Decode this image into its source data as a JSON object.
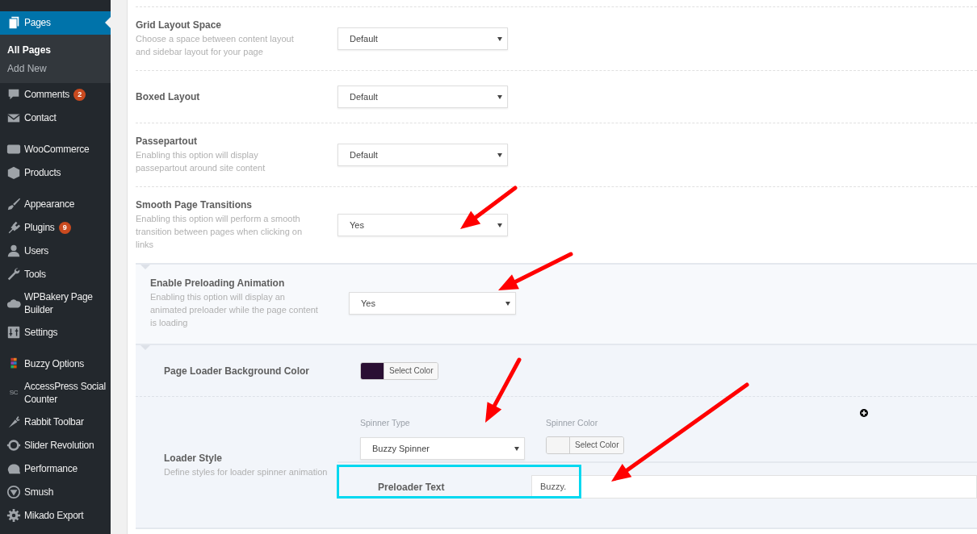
{
  "sidebar": {
    "groups": [
      {
        "items": [
          {
            "label": "Pages",
            "selected": true,
            "children": [
              {
                "label": "All Pages",
                "selected": true
              },
              {
                "label": "Add New",
                "selected": false
              }
            ]
          },
          {
            "label": "Comments",
            "badge": "2",
            "selected": false
          },
          {
            "label": "Contact",
            "selected": false
          }
        ]
      },
      {
        "items": [
          {
            "label": "WooCommerce",
            "selected": false
          },
          {
            "label": "Products",
            "selected": false
          }
        ]
      },
      {
        "items": [
          {
            "label": "Appearance",
            "selected": false
          },
          {
            "label": "Plugins",
            "badge": "9",
            "selected": false
          },
          {
            "label": "Users",
            "selected": false
          },
          {
            "label": "Tools",
            "selected": false
          },
          {
            "label": "WPBakery Page Builder",
            "selected": false
          },
          {
            "label": "Settings",
            "selected": false
          }
        ]
      },
      {
        "items": [
          {
            "label": "Buzzy Options",
            "selected": false
          },
          {
            "label": "AccessPress Social Counter",
            "icon_text": "SC",
            "selected": false
          },
          {
            "label": "Rabbit Toolbar",
            "selected": false
          },
          {
            "label": "Slider Revolution",
            "selected": false
          },
          {
            "label": "Performance",
            "selected": false
          },
          {
            "label": "Smush",
            "selected": false
          },
          {
            "label": "Mikado Export",
            "selected": false
          }
        ]
      }
    ]
  },
  "settings": [
    {
      "label": "Grid Layout Space",
      "description": "Choose a space between content layout and sidebar layout for your page",
      "value": "Default"
    },
    {
      "label": "Boxed Layout",
      "value": "Default"
    },
    {
      "label": "Passepartout",
      "description": "Enabling this option will display passepartout around site content",
      "value": "Default"
    },
    {
      "label": "Smooth Page Transitions",
      "description": "Enabling this option will perform a smooth transition between pages when clicking on links",
      "value": "Yes"
    }
  ],
  "preloading": {
    "label": "Enable Preloading Animation",
    "description": "Enabling this option will display an animated preloader while the page content is loading",
    "value": "Yes"
  },
  "loader": {
    "background": {
      "label": "Page Loader Background Color",
      "color": "#2a0f33",
      "button": "Select Color"
    },
    "style": {
      "label": "Loader Style",
      "description": "Define styles for loader spinner animation",
      "spinner_type": {
        "label": "Spinner Type",
        "value": "Buzzy Spinner"
      },
      "spinner_color": {
        "label": "Spinner Color",
        "button": "Select Color"
      },
      "preloader_text": {
        "label": "Preloader Text",
        "value": "Buzzy."
      }
    }
  }
}
